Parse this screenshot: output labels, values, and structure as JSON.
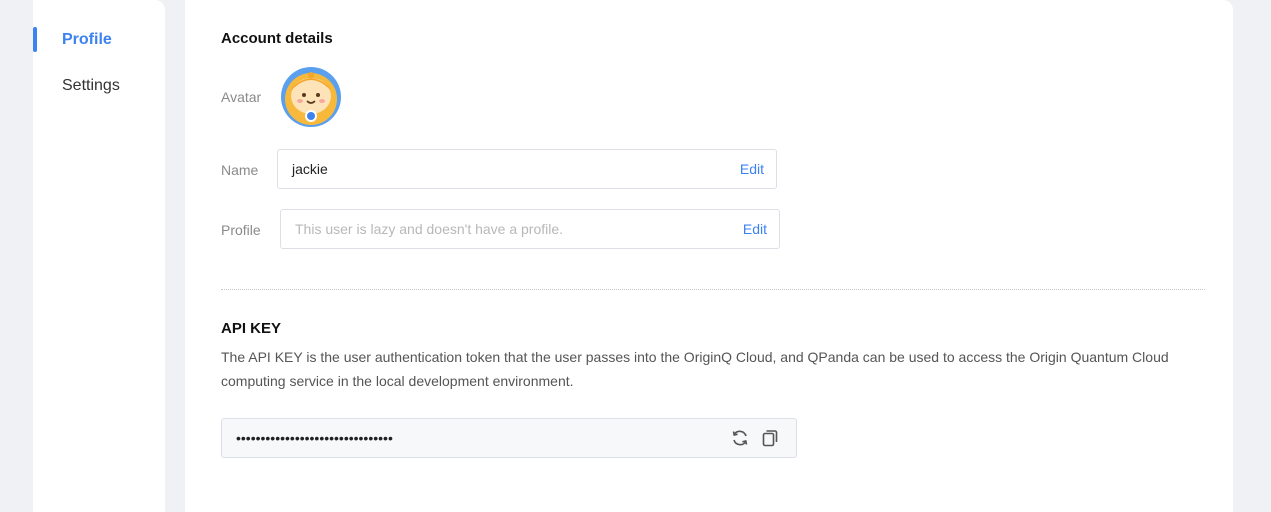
{
  "sidebar": {
    "items": [
      {
        "label": "Profile",
        "active": true
      },
      {
        "label": "Settings",
        "active": false
      }
    ]
  },
  "account": {
    "title": "Account details",
    "avatar_label": "Avatar",
    "name_label": "Name",
    "name_value": "jackie",
    "name_edit": "Edit",
    "profile_label": "Profile",
    "profile_placeholder": "This user is lazy and doesn't have a profile.",
    "profile_edit": "Edit"
  },
  "api": {
    "title": "API KEY",
    "description": "The API KEY is the user authentication token that the user passes into the OriginQ Cloud, and QPanda can be used to access the Origin Quantum Cloud computing service in the local development environment.",
    "key_masked": "••••••••••••••••••••••••••••••••",
    "refresh_icon": "refresh-icon",
    "copy_icon": "copy-icon"
  },
  "colors": {
    "accent": "#3c82f0",
    "background": "#f0f1f5"
  }
}
